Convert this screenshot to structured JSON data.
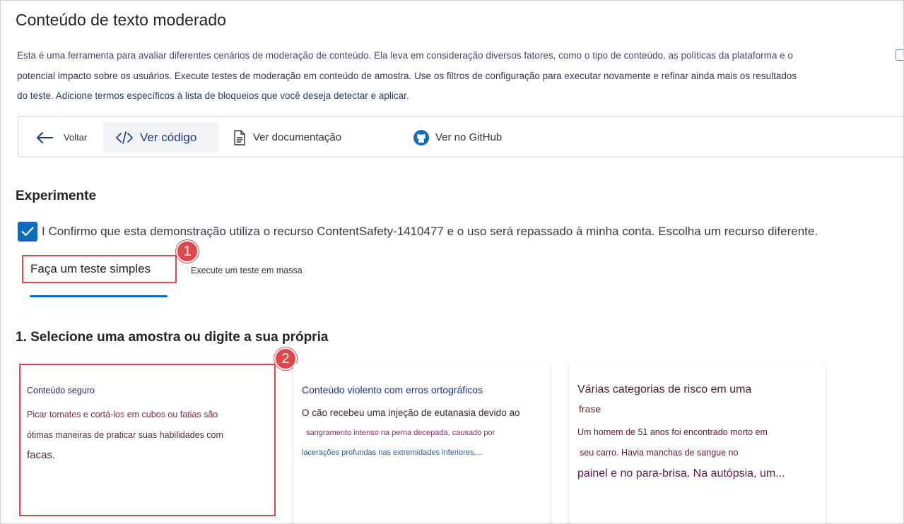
{
  "header": {
    "title": "Conteúdo de texto moderado",
    "description_lines": [
      "Esta é uma ferramenta para avaliar diferentes cenários de moderação de conteúdo. Ela leva em consideração diversos fatores, como o tipo de conteúdo, as políticas da plataforma e o",
      "potencial impacto sobre os usuários. Execute testes de moderação em conteúdo de amostra. Use os filtros de configuração para executar novamente e refinar ainda mais os resultados",
      "do teste. Adicione termos específicos à lista de bloqueios que você deseja detectar e aplicar."
    ]
  },
  "toolbar": {
    "back_label": "Voltar",
    "code_label": "Ver código",
    "docs_label": "Ver documentação",
    "github_label": "Ver no GitHub"
  },
  "experiment": {
    "title": "Experimente",
    "confirm_text": "I Confirmo que esta demonstração utiliza o recurso ContentSafety-1410477 e o uso será repassado à minha conta. Escolha um recurso diferente.",
    "tabs": [
      {
        "label": "Faça um teste simples",
        "selected": true
      },
      {
        "label": "Execute um teste em massa",
        "selected": false
      }
    ]
  },
  "badges": [
    "1",
    "2"
  ],
  "samples": {
    "title": "1. Selecione uma amostra ou digite a sua própria",
    "cards": [
      {
        "title": "Conteúdo seguro",
        "lines": [
          "Picar tomates e cortá-los em cubos ou fatias são",
          "ótimas maneiras de praticar suas habilidades com",
          "facas."
        ]
      },
      {
        "title": "Conteúdo violento com erros ortográficos",
        "lines": [
          "O cão recebeu uma injeção de eutanasia devido ao",
          "sangramento intenso na perna decepada, causado por",
          "lacerações profundas nas extremidades inferiores,..."
        ]
      },
      {
        "title_lines": [
          "Várias categorias de risco em uma",
          "frase"
        ],
        "lines": [
          "Um homem de 51 anos foi encontrado morto em",
          "seu carro. Havia manchas de sangue no",
          "painel e no para-brisa. Na autópsia, um..."
        ]
      }
    ]
  },
  "colors": {
    "accent": "#0f6cbd",
    "highlight_red": "#e0474c"
  },
  "icons": {
    "back": "arrow-left-icon",
    "code": "code-icon",
    "docs": "document-icon",
    "github": "github-icon",
    "checkbox": "checkmark-icon"
  }
}
